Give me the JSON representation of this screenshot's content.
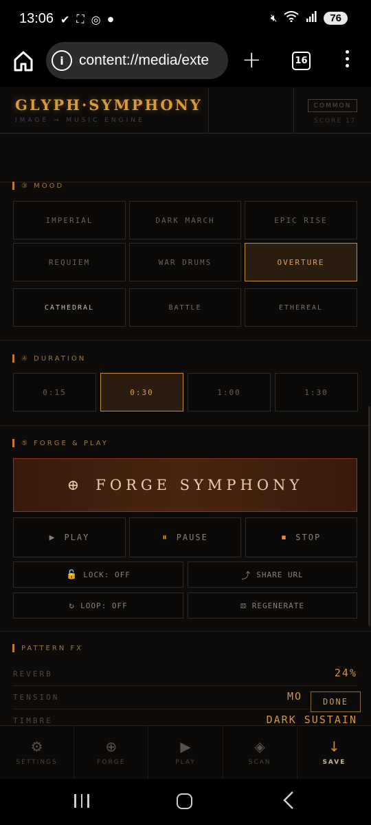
{
  "status_bar": {
    "time": "13:06",
    "left_icons": [
      "check-icon",
      "screenshot-icon",
      "instagram-icon",
      "dot-icon"
    ],
    "right_icons": [
      "mute-icon",
      "wifi-icon",
      "signal-icon"
    ],
    "battery": "76"
  },
  "browser": {
    "url": "content://media/exte",
    "tab_count": "16"
  },
  "app": {
    "logo": "GLYPH·SYMPHONY",
    "subtitle": "IMAGE → MUSIC ENGINE",
    "rarity_badge": "COMMON",
    "score": "SCORE 17"
  },
  "mood": {
    "label": "③ MOOD",
    "options": [
      {
        "label": "IMPERIAL",
        "active": false
      },
      {
        "label": "DARK MARCH",
        "active": false
      },
      {
        "label": "EPIC RISE",
        "active": false
      },
      {
        "label": "REQUIEM",
        "active": false
      },
      {
        "label": "WAR DRUMS",
        "active": false
      },
      {
        "label": "OVERTURE",
        "active": true
      },
      {
        "label": "CATHEDRAL",
        "active": false
      },
      {
        "label": "BATTLE",
        "active": false
      },
      {
        "label": "ETHEREAL",
        "active": false
      }
    ]
  },
  "duration": {
    "label": "④ DURATION",
    "options": [
      {
        "label": "0:15",
        "active": false
      },
      {
        "label": "0:30",
        "active": true
      },
      {
        "label": "1:00",
        "active": false
      },
      {
        "label": "1:30",
        "active": false
      }
    ]
  },
  "forge_play": {
    "label": "⑤ FORGE & PLAY",
    "forge_icon": "⊕",
    "forge_button": "FORGE SYMPHONY",
    "play": {
      "icon": "▶",
      "label": "PLAY"
    },
    "pause": {
      "icon": "⏸",
      "label": "PAUSE"
    },
    "stop": {
      "icon": "⏹",
      "label": "STOP"
    },
    "lock": {
      "icon": "🔓",
      "label": "LOCK: OFF"
    },
    "share": {
      "icon": "⤴",
      "label": "SHARE URL"
    },
    "loop": {
      "icon": "↻",
      "label": "LOOP: OFF"
    },
    "regenerate": {
      "icon": "⚄",
      "label": "REGENERATE"
    }
  },
  "pattern_fx": {
    "label": "PATTERN FX",
    "rows": [
      {
        "name": "REVERB",
        "value": "24%"
      },
      {
        "name": "TENSION",
        "value": "MO"
      },
      {
        "name": "TIMBRE",
        "value": "DARK SUSTAIN"
      }
    ],
    "done_button": "DONE"
  },
  "bottom_nav": [
    {
      "icon": "⚙",
      "label": "SETTINGS"
    },
    {
      "icon": "⊕",
      "label": "FORGE"
    },
    {
      "icon": "▶",
      "label": "PLAY"
    },
    {
      "icon": "◈",
      "label": "SCAN"
    },
    {
      "icon": "↓",
      "label": "SAVE"
    }
  ],
  "colors": {
    "accent": "#d99a3e",
    "background": "#0d0b09",
    "active_border": "#c58a3c",
    "forge_border": "#8a3a20"
  }
}
